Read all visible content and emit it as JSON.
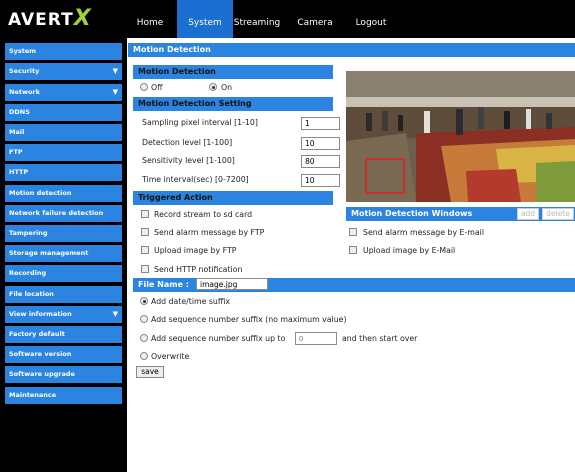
{
  "app": {
    "logo_main": "AVERT",
    "logo_x": "X"
  },
  "nav": {
    "items": [
      "Home",
      "System",
      "Streaming",
      "Camera",
      "Logout"
    ],
    "active": "System"
  },
  "sidebar": {
    "items": [
      {
        "label": "System",
        "arrow": false
      },
      {
        "label": "Security",
        "arrow": true
      },
      {
        "label": "Network",
        "arrow": true
      },
      {
        "label": "DDNS",
        "arrow": false
      },
      {
        "label": "Mail",
        "arrow": false
      },
      {
        "label": "FTP",
        "arrow": false
      },
      {
        "label": "HTTP",
        "arrow": false
      },
      {
        "label": "Motion detection",
        "arrow": false
      },
      {
        "label": "Network failure detection",
        "arrow": false
      },
      {
        "label": "Tampering",
        "arrow": false
      },
      {
        "label": "Storage management",
        "arrow": false
      },
      {
        "label": "Recording",
        "arrow": false
      },
      {
        "label": "File location",
        "arrow": false
      },
      {
        "label": "View information",
        "arrow": true
      },
      {
        "label": "Factory default",
        "arrow": false
      },
      {
        "label": "Software version",
        "arrow": false
      },
      {
        "label": "Software upgrade",
        "arrow": false
      },
      {
        "label": "Maintenance",
        "arrow": false
      }
    ],
    "arrow_glyph": "▼"
  },
  "main": {
    "title": "Motion Detection",
    "md_section": "Motion Detection",
    "off_label": "Off",
    "on_label": "On",
    "md_state": "On",
    "setting_section": "Motion Detection Setting",
    "settings": [
      {
        "label": "Sampling pixel interval [1-10]",
        "value": "1"
      },
      {
        "label": "Detection level [1-100]",
        "value": "10"
      },
      {
        "label": "Sensitivity level [1-100]",
        "value": "80"
      },
      {
        "label": "Time interval(sec) [0-7200]",
        "value": "10"
      }
    ],
    "triggered_section": "Triggered Action",
    "actions_left": [
      "Record stream to sd card",
      "Send alarm message by FTP",
      "Upload image by FTP",
      "Send HTTP notification"
    ],
    "windows_section": "Motion Detection Windows",
    "add_label": "add",
    "delete_label": "delete",
    "actions_right": [
      "Send alarm message by E-mail",
      "Upload image by E-Mail"
    ],
    "filename_label": "File Name :",
    "filename_value": "image.jpg",
    "suffix_options": [
      "Add date/time suffix",
      "Add sequence number suffix (no maximum value)",
      "Add sequence number suffix up to",
      "Overwrite"
    ],
    "suffix_selected": "Add date/time suffix",
    "suffix_upto_placeholder": "0",
    "suffix_upto_after": "and then start over",
    "save_label": "save"
  },
  "colors": {
    "accent": "#2a84e0",
    "nav_active": "#1a6fd1",
    "logo_x": "#9fd13a",
    "motion_box": "#e01e1e"
  }
}
